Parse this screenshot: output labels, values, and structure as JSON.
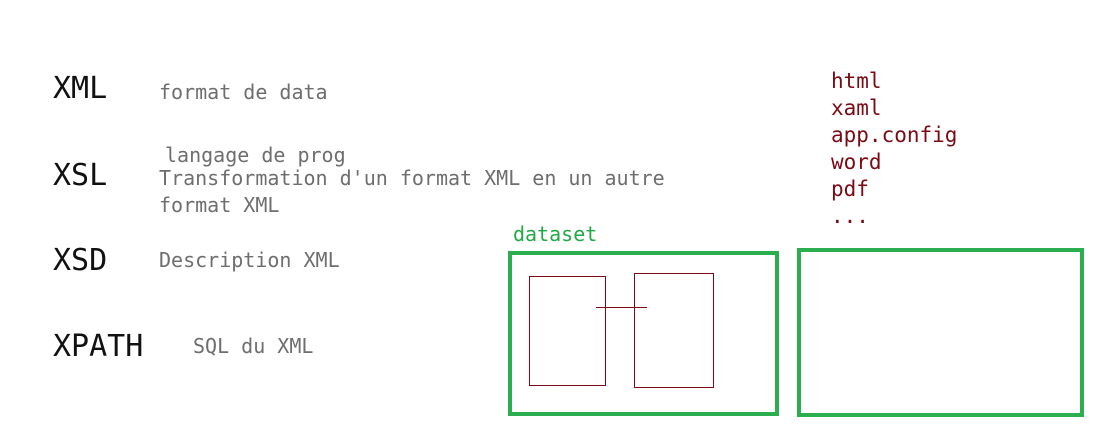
{
  "terms": [
    {
      "name": "XML",
      "lines": [
        "format de data"
      ]
    },
    {
      "name": "XSL",
      "note": "langage de prog",
      "lines": [
        "Transformation d'un format XML en un autre",
        "format XML"
      ]
    },
    {
      "name": "XSD",
      "lines": [
        "Description XML"
      ]
    },
    {
      "name": "XPATH",
      "lines": [
        "SQL du XML"
      ]
    }
  ],
  "formats": [
    "html",
    "xaml",
    "app.config",
    "word",
    "pdf",
    "..."
  ],
  "dataset": {
    "label": "dataset"
  },
  "colors": {
    "term": "#111111",
    "description": "#6e6e6e",
    "formats": "#7a0a14",
    "green": "#2aae4e",
    "table_outline": "#7a0a14"
  }
}
